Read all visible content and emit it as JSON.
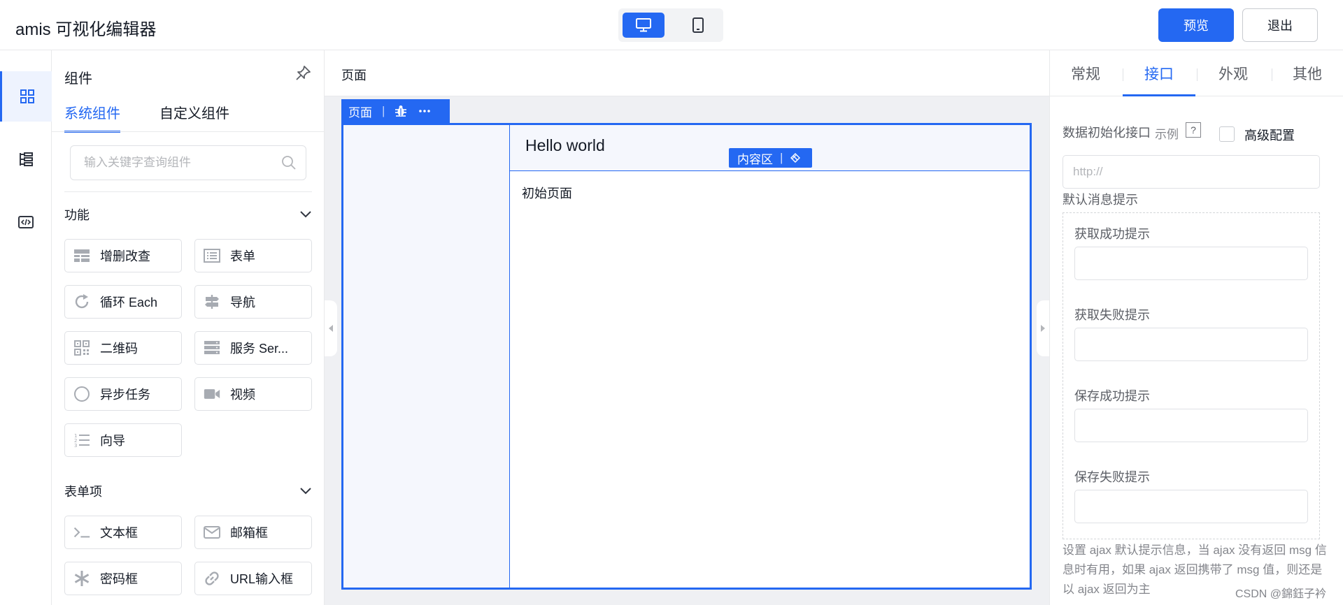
{
  "header": {
    "title": "amis 可视化编辑器",
    "preview_label": "预览",
    "exit_label": "退出",
    "device_modes": [
      "desktop-icon",
      "tablet-icon"
    ],
    "active_device": "desktop"
  },
  "rail": {
    "items": [
      "components-icon",
      "outline-tree-icon",
      "code-icon"
    ],
    "active": "components"
  },
  "panel": {
    "title": "组件",
    "tabs": [
      "系统组件",
      "自定义组件"
    ],
    "search_placeholder": "输入关键字查询组件",
    "groups": [
      {
        "label": "功能",
        "items": [
          {
            "label": "增删改查",
            "icon": "crud-icon"
          },
          {
            "label": "表单",
            "icon": "form-icon"
          },
          {
            "label": "循环 Each",
            "icon": "loop-icon"
          },
          {
            "label": "导航",
            "icon": "nav-icon"
          },
          {
            "label": "二维码",
            "icon": "qrcode-icon"
          },
          {
            "label": "服务 Ser...",
            "icon": "service-icon"
          },
          {
            "label": "异步任务",
            "icon": "async-task-icon"
          },
          {
            "label": "视频",
            "icon": "video-icon"
          },
          {
            "label": "向导",
            "icon": "wizard-icon"
          }
        ]
      },
      {
        "label": "表单项",
        "items": [
          {
            "label": "文本框",
            "icon": "terminal-icon"
          },
          {
            "label": "邮箱框",
            "icon": "mail-icon"
          },
          {
            "label": "密码框",
            "icon": "asterisk-icon"
          },
          {
            "label": "URL输入框",
            "icon": "link-icon"
          }
        ]
      }
    ]
  },
  "canvas": {
    "breadcrumb": "页面",
    "page_toolbar": {
      "label": "页面",
      "icons": [
        "bug-icon",
        "more-icon"
      ]
    },
    "header_title": "Hello world",
    "content_toolbar": {
      "label": "内容区",
      "icon": "drag-layers-icon"
    },
    "body_text": "初始页面"
  },
  "config": {
    "tabs": [
      "常规",
      "接口",
      "外观",
      "其他"
    ],
    "active_tab": "接口",
    "init_api_label": "数据初始化接口",
    "example_label": "示例",
    "help_mark": "?",
    "advanced_label": "高级配置",
    "api_placeholder": "http://",
    "default_msg_label": "默认消息提示",
    "messages": [
      {
        "label": "获取成功提示",
        "value": ""
      },
      {
        "label": "获取失败提示",
        "value": ""
      },
      {
        "label": "保存成功提示",
        "value": ""
      },
      {
        "label": "保存失败提示",
        "value": ""
      }
    ],
    "help_text": "设置 ajax 默认提示信息，当 ajax 没有返回 msg 信息时有用，如果 ajax 返回携带了 msg 值，则还是以 ajax 返回为主"
  },
  "watermark": "CSDN @錦鈺子衿",
  "colors": {
    "primary": "#2468f2",
    "aside_bg": "#f5f7fd",
    "canvas_bg": "#eff0f3"
  }
}
